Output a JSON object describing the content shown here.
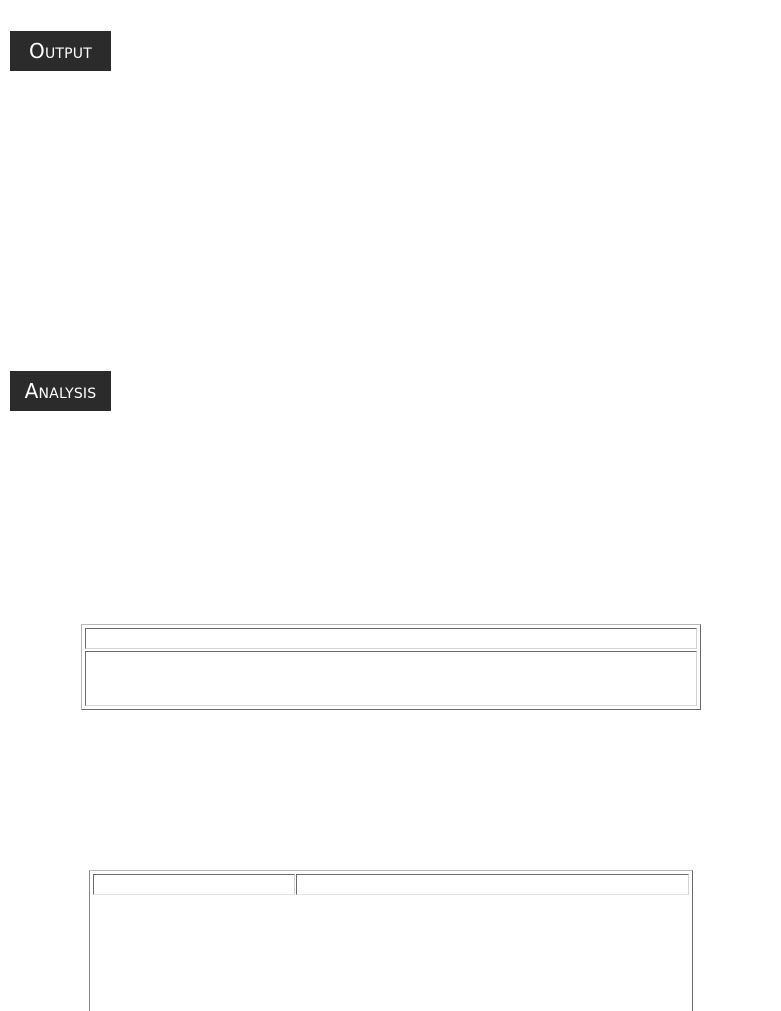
{
  "headings": {
    "output": "Output",
    "analysis": "Analysis"
  },
  "table1": {
    "header_text": "",
    "body_text": ""
  },
  "table2": {
    "col1_header": "",
    "col2_header": ""
  }
}
